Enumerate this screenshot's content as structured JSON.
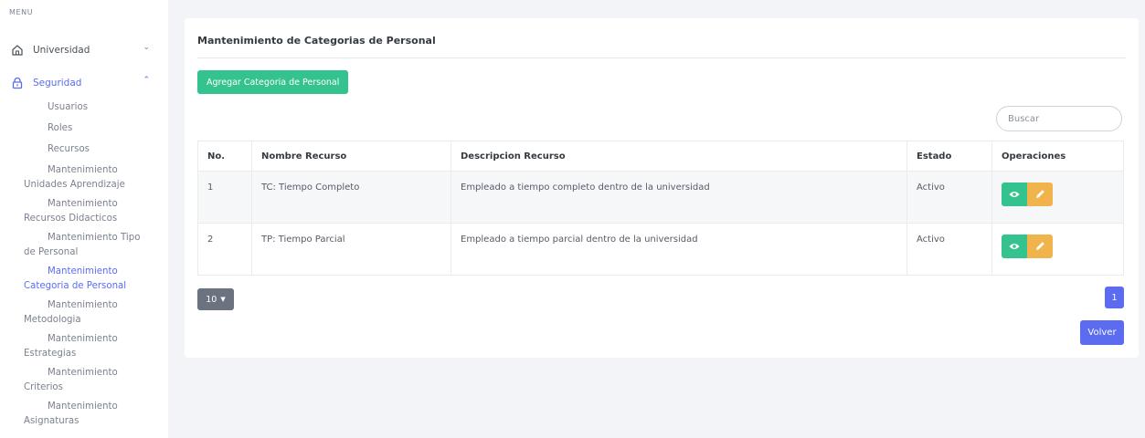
{
  "sidebar": {
    "menu_title": "MENU",
    "universidad": {
      "label": "Universidad",
      "icon": "home-icon"
    },
    "seguridad": {
      "label": "Seguridad",
      "icon": "lock-icon"
    },
    "subitems": [
      {
        "line1": "Usuarios"
      },
      {
        "line1": "Roles"
      },
      {
        "line1": "Recursos"
      },
      {
        "line1": "Mantenimiento",
        "line2": "Unidades Aprendizaje"
      },
      {
        "line1": "Mantenimiento",
        "line2": "Recursos Didacticos"
      },
      {
        "line1": "Mantenimiento Tipo",
        "line2": "de Personal"
      },
      {
        "line1": "Mantenimiento",
        "line2": "Categoria de Personal"
      },
      {
        "line1": "Mantenimiento",
        "line2": "Metodologia"
      },
      {
        "line1": "Mantenimiento",
        "line2": "Estrategias"
      },
      {
        "line1": "Mantenimiento",
        "line2": "Criterios"
      },
      {
        "line1": "Mantenimiento",
        "line2": "Asignaturas"
      }
    ]
  },
  "main": {
    "title": "Mantenimiento de Categorias de Personal",
    "add_button": "Agregar Categoria de Personal",
    "search_placeholder": "Buscar",
    "table": {
      "headers": [
        "No.",
        "Nombre Recurso",
        "Descripcion Recurso",
        "Estado",
        "Operaciones"
      ],
      "rows": [
        {
          "no": "1",
          "nombre": "TC: Tiempo Completo",
          "descripcion": "Empleado a tiempo completo dentro de la universidad",
          "estado": "Activo"
        },
        {
          "no": "2",
          "nombre": "TP: Tiempo Parcial",
          "descripcion": "Empleado a tiempo parcial dentro de la universidad",
          "estado": "Activo"
        }
      ]
    },
    "page_size": "10",
    "current_page": "1",
    "back_button": "Volver"
  },
  "colors": {
    "primary": "#5b6cf0",
    "success": "#34c38f",
    "warning": "#f1b44c",
    "secondary": "#6b7280"
  }
}
